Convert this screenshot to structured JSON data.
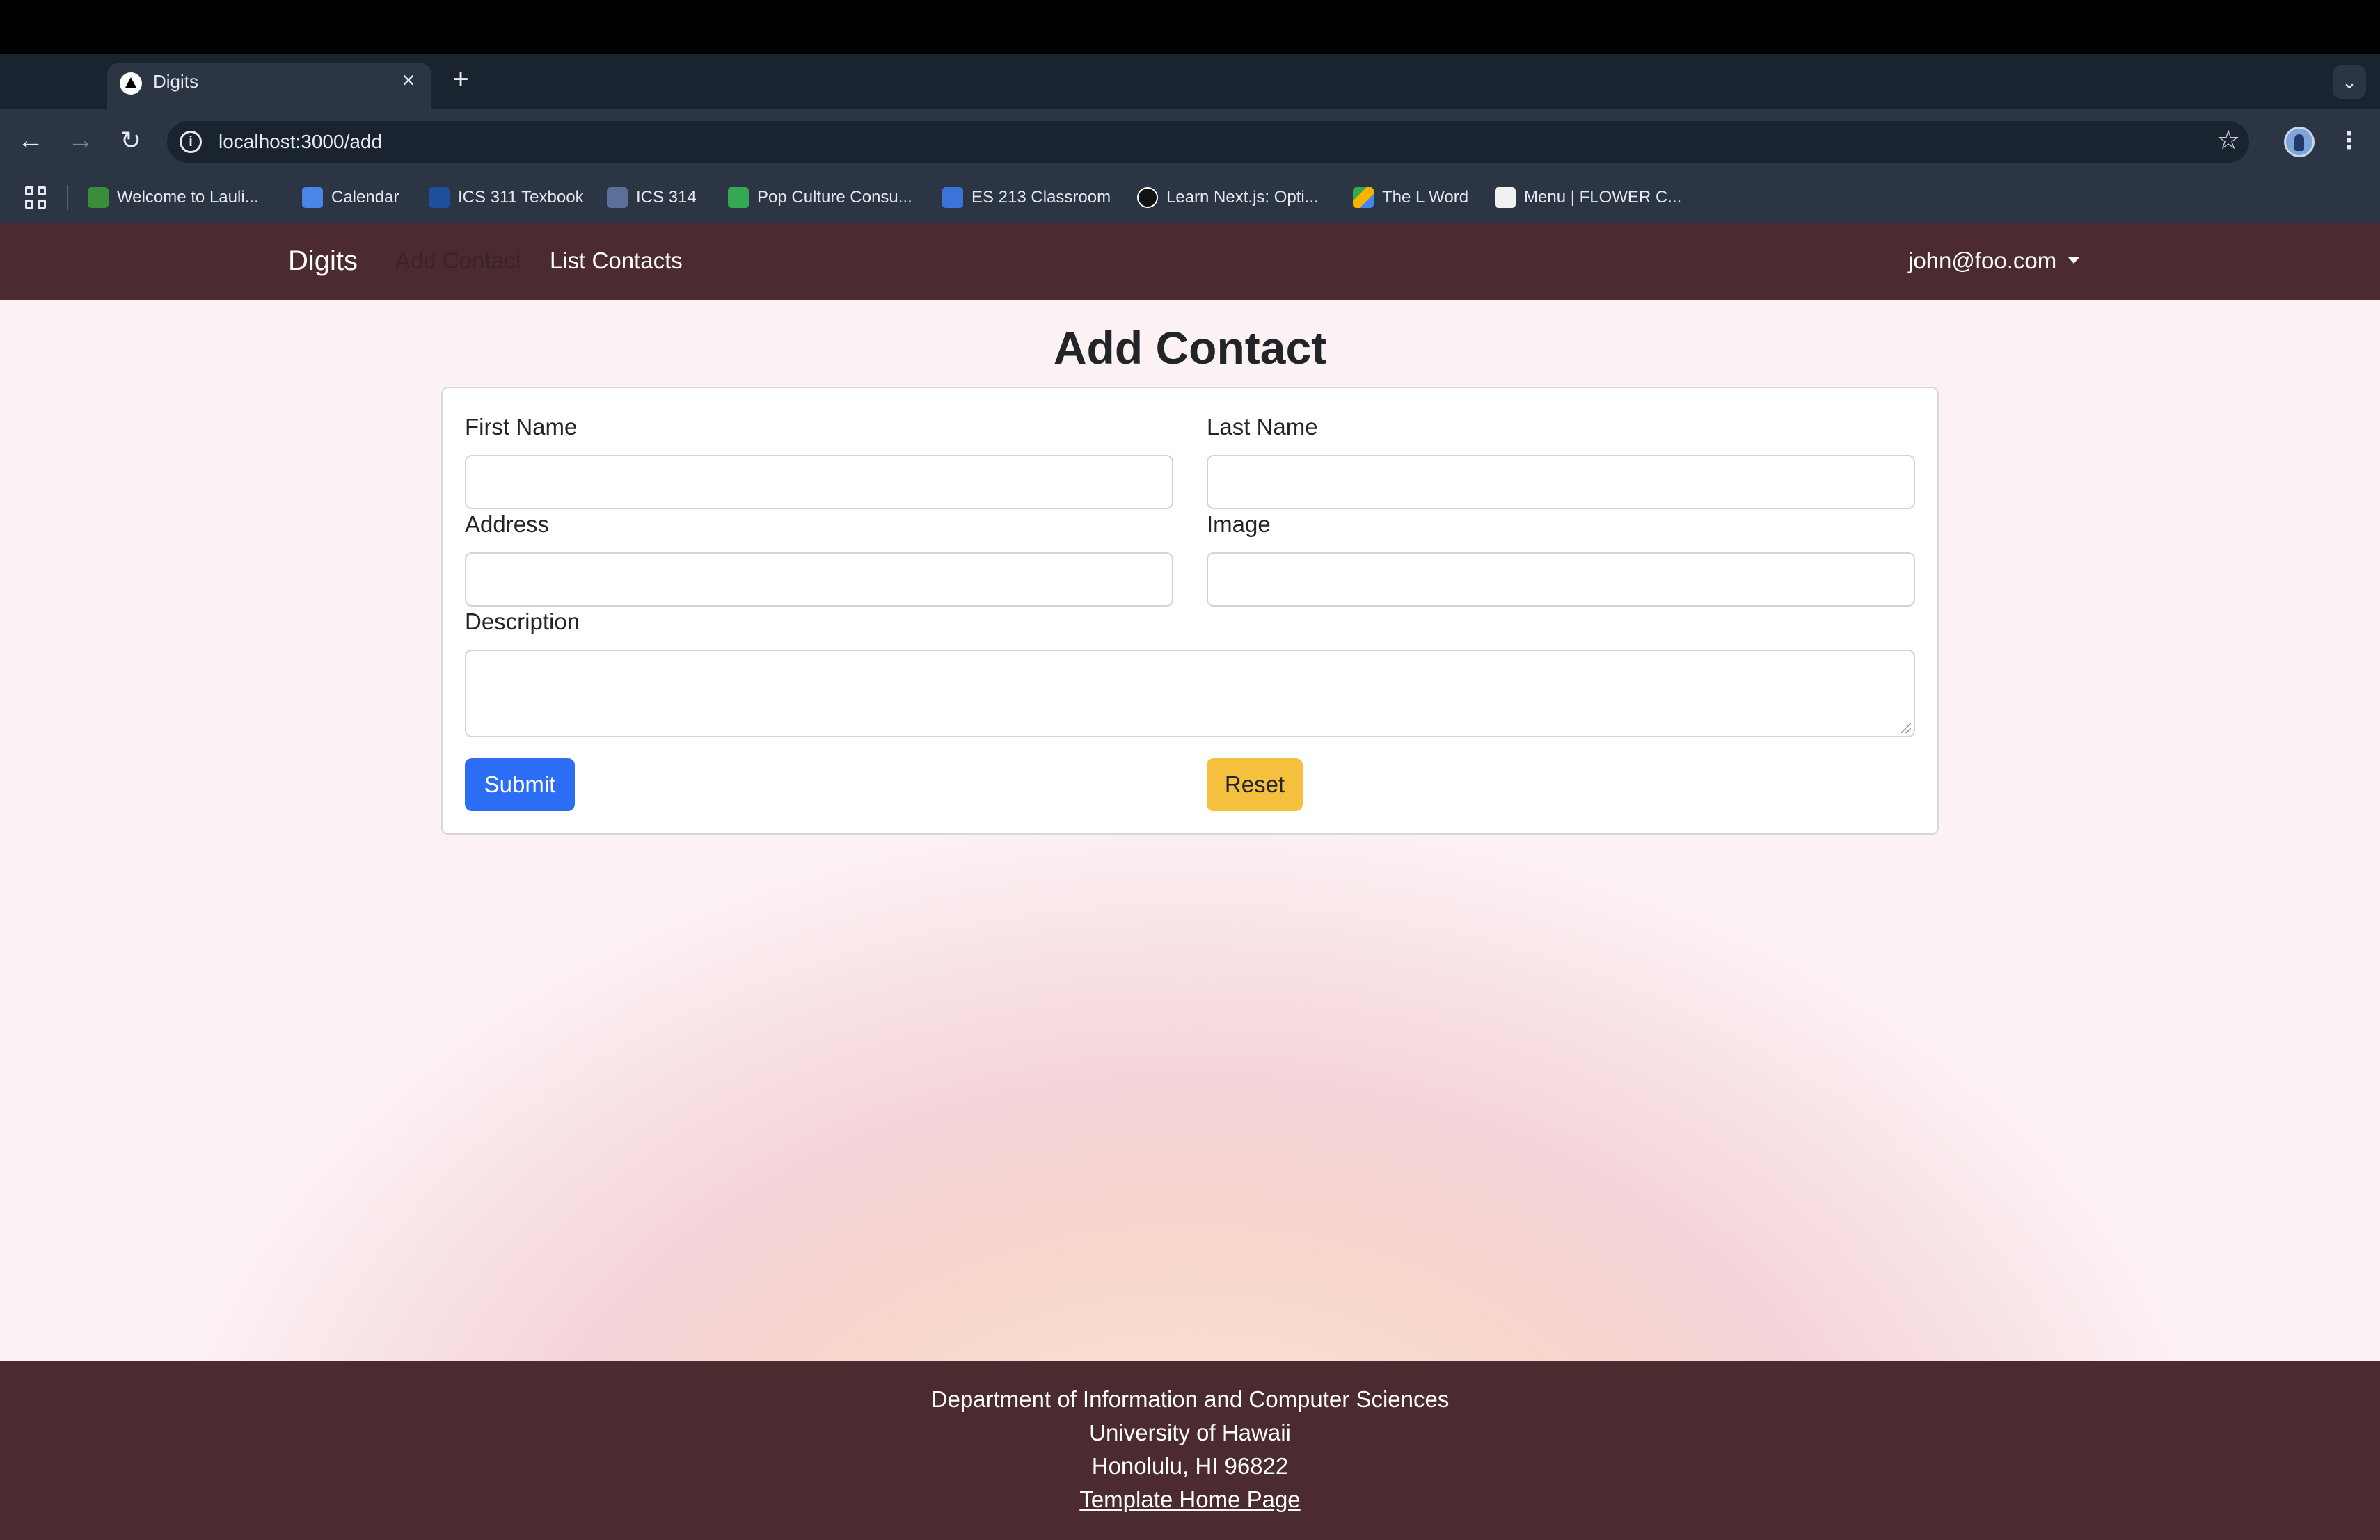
{
  "browser": {
    "tab_title": "Digits",
    "tab_close_icon": "close-icon",
    "new_tab_icon": "plus-icon",
    "url": "localhost:3000/add",
    "bookmarks": [
      {
        "label": "Welcome to Lauli...",
        "color": "#3a8d3a"
      },
      {
        "label": "Calendar",
        "color": "#4a86e8"
      },
      {
        "label": "ICS 311 Texbook",
        "color": "#1d4f9c"
      },
      {
        "label": "ICS 314",
        "color": "#5a6f9a"
      },
      {
        "label": "Pop Culture Consu...",
        "color": "#34a853"
      },
      {
        "label": "ES 213 Classroom",
        "color": "#3b74d8"
      },
      {
        "label": "Learn Next.js: Opti...",
        "color": "#111111"
      },
      {
        "label": "The L Word",
        "color": "#f4b400"
      },
      {
        "label": "Menu | FLOWER C...",
        "color": "#f1f1f1"
      }
    ]
  },
  "navbar": {
    "brand": "Digits",
    "add_contact": "Add Contact",
    "list_contacts": "List Contacts",
    "user": "john@foo.com",
    "background": "#4b2b2f"
  },
  "form": {
    "title": "Add Contact",
    "first_name_label": "First Name",
    "first_name_value": "",
    "last_name_label": "Last Name",
    "last_name_value": "",
    "address_label": "Address",
    "address_value": "",
    "image_label": "Image",
    "image_value": "",
    "description_label": "Description",
    "description_value": "",
    "submit_label": "Submit",
    "reset_label": "Reset",
    "submit_color": "#2b6ef5",
    "reset_color": "#f4c03d"
  },
  "footer": {
    "line1": "Department of Information and Computer Sciences",
    "line2": "University of Hawaii",
    "line3": "Honolulu, HI 96822",
    "link": "Template Home Page"
  }
}
